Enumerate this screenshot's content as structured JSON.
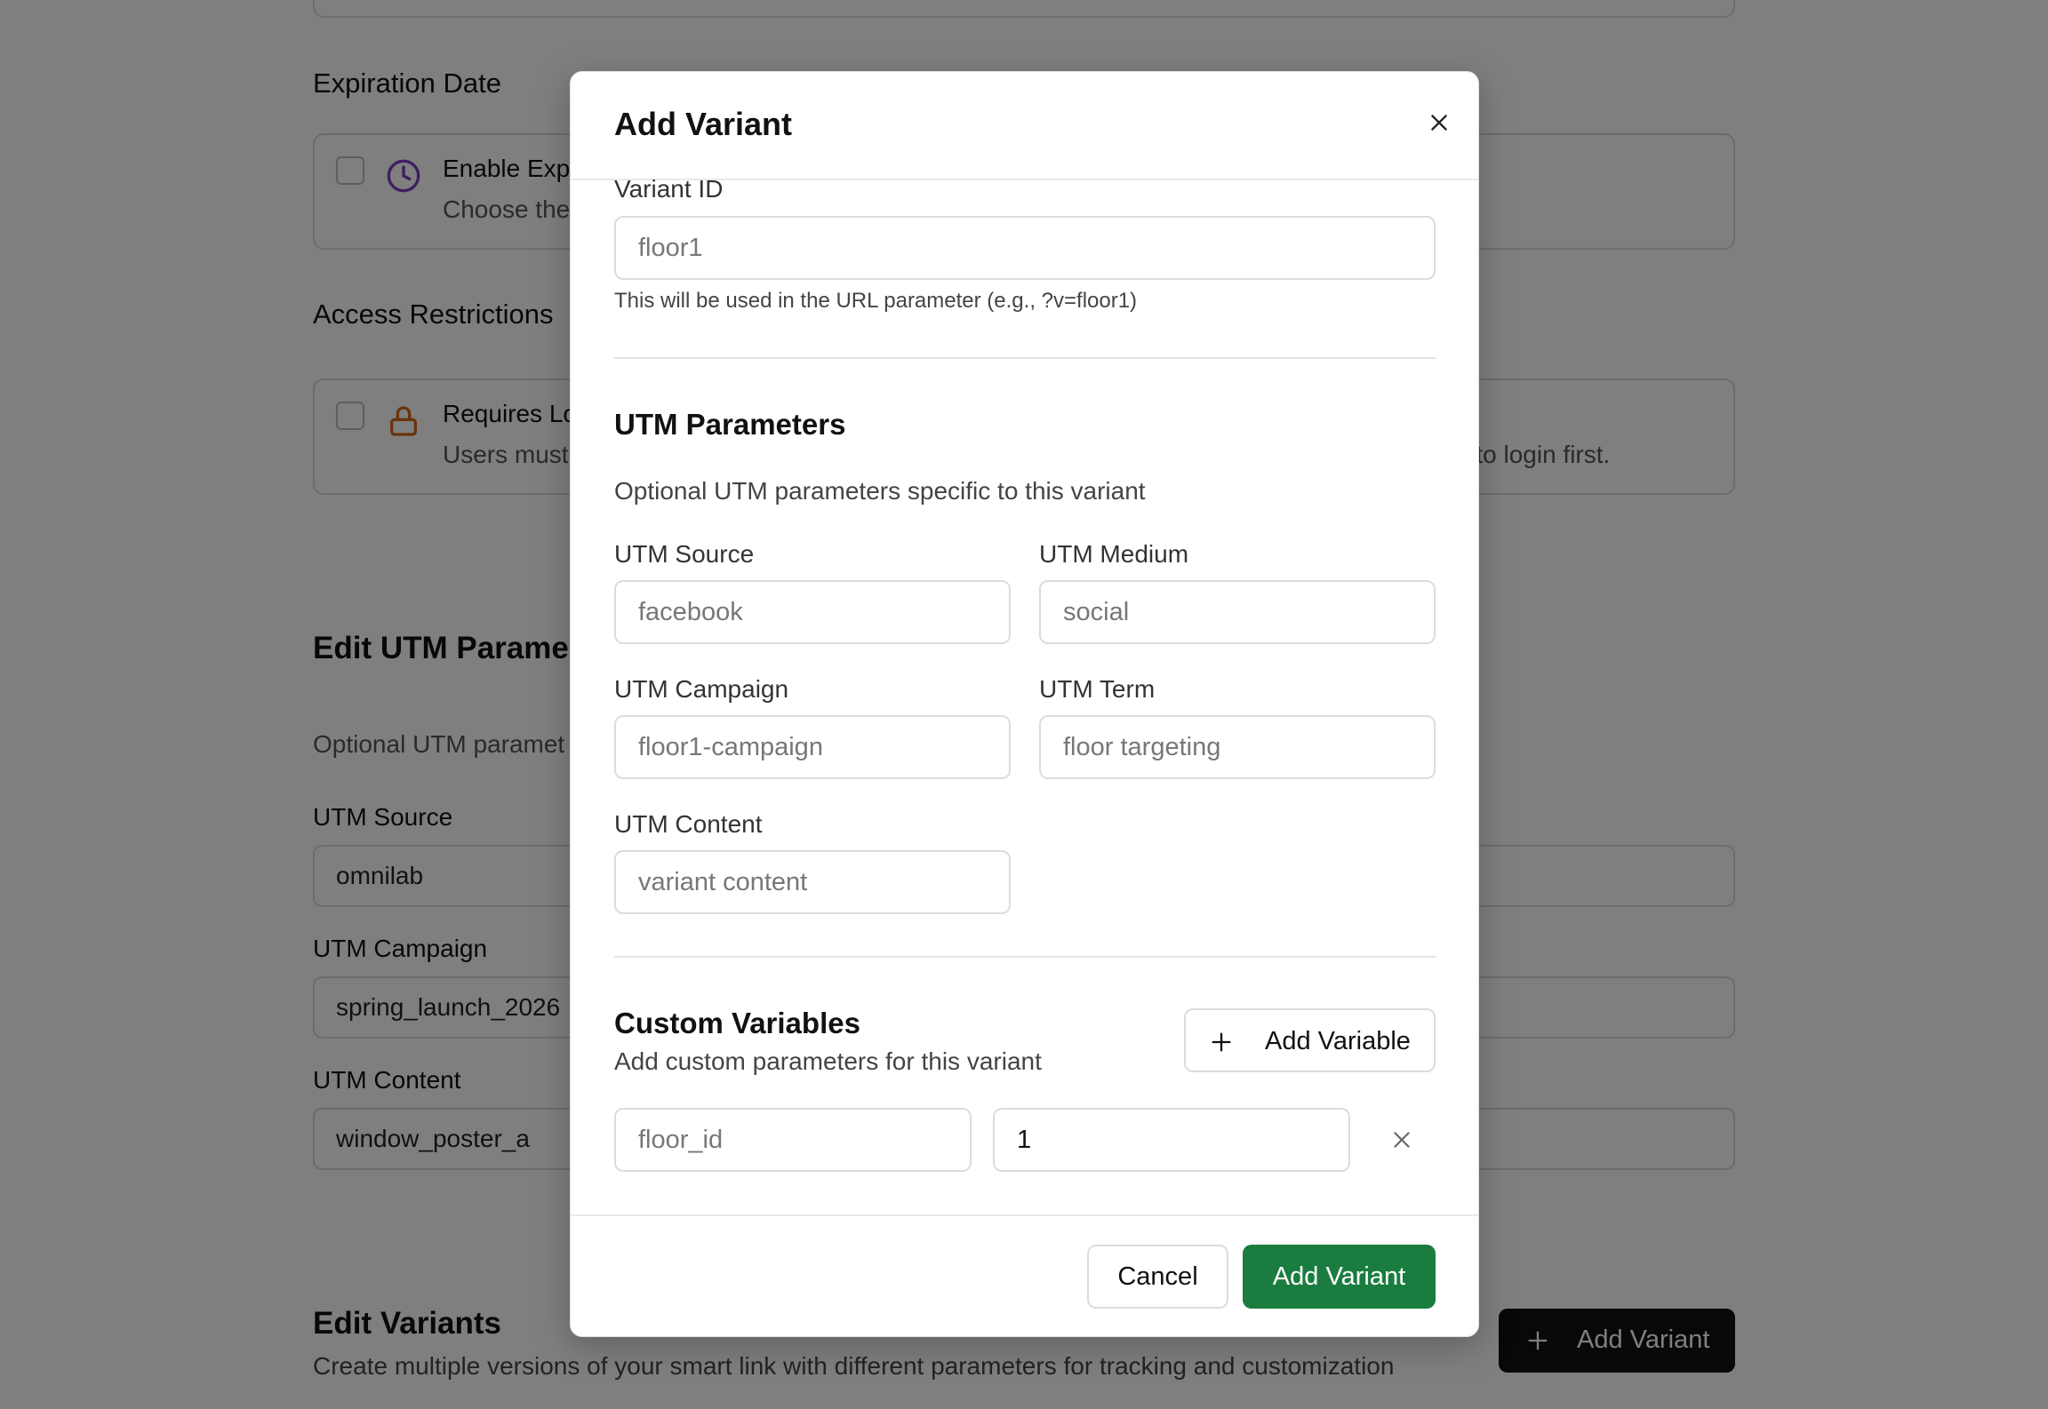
{
  "background": {
    "expiration": {
      "section_title": "Expiration Date",
      "option_title": "Enable Exp",
      "option_desc": "Choose the"
    },
    "access": {
      "section_title": "Access Restrictions",
      "option_title": "Requires Lo",
      "option_desc": "Users must",
      "option_desc_tail": "d to login first."
    },
    "utm": {
      "heading": "Edit UTM Parame",
      "desc": "Optional UTM paramet",
      "source_label": "UTM Source",
      "source_value": "omnilab",
      "campaign_label": "UTM Campaign",
      "campaign_value": "spring_launch_2026",
      "content_label": "UTM Content",
      "content_value": "window_poster_a"
    },
    "variants": {
      "heading": "Edit Variants",
      "desc": "Create multiple versions of your smart link with different parameters for tracking and customization",
      "add_button": "Add Variant"
    },
    "colors": {
      "clock_icon": "#7b3fc4",
      "lock_icon": "#d9661a"
    }
  },
  "modal": {
    "title": "Add Variant",
    "variant_id": {
      "label": "Variant ID",
      "placeholder": "floor1",
      "help": "This will be used in the URL parameter (e.g., ?v=floor1)"
    },
    "utm": {
      "title": "UTM Parameters",
      "desc": "Optional UTM parameters specific to this variant",
      "source": {
        "label": "UTM Source",
        "placeholder": "facebook"
      },
      "medium": {
        "label": "UTM Medium",
        "placeholder": "social"
      },
      "campaign": {
        "label": "UTM Campaign",
        "placeholder": "floor1-campaign"
      },
      "term": {
        "label": "UTM Term",
        "placeholder": "floor targeting"
      },
      "content": {
        "label": "UTM Content",
        "placeholder": "variant content"
      }
    },
    "custom": {
      "title": "Custom Variables",
      "desc": "Add custom parameters for this variant",
      "add_button": "Add Variable",
      "rows": [
        {
          "key_placeholder": "floor_id",
          "value": "1"
        }
      ]
    },
    "footer": {
      "cancel": "Cancel",
      "submit": "Add Variant"
    },
    "colors": {
      "primary": "#1a7d3f"
    }
  }
}
